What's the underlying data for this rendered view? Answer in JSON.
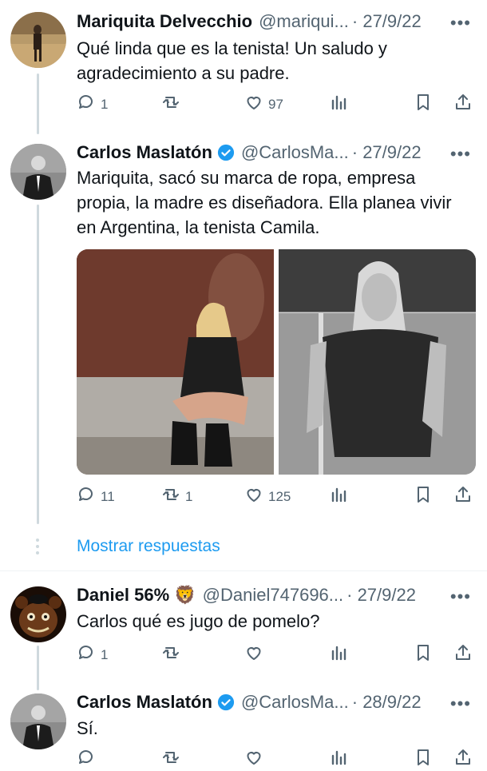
{
  "tweets": [
    {
      "name": "Mariquita Delvecchio",
      "handle": "@mariqui...",
      "date": "· 27/9/22",
      "verified": false,
      "text": "Qué linda que es la tenista!  Un saludo y agradecimiento a su padre.",
      "replies": "1",
      "retweets": "",
      "likes": "97"
    },
    {
      "name": "Carlos Maslatón",
      "handle": "@CarlosMa...",
      "date": "· 27/9/22",
      "verified": true,
      "text": "Mariquita, sacó su marca de ropa, empresa propia, la madre es diseñadora. Ella planea vivir en Argentina, la tenista Camila.",
      "replies": "11",
      "retweets": "1",
      "likes": "125"
    },
    {
      "name": "Daniel 56% 🦁",
      "handle": "@Daniel747696...",
      "date": "· 27/9/22",
      "verified": false,
      "text": "Carlos qué es jugo de pomelo?",
      "replies": "1",
      "retweets": "",
      "likes": ""
    },
    {
      "name": "Carlos Maslatón",
      "handle": "@CarlosMa...",
      "date": "· 28/9/22",
      "verified": true,
      "text": "Sí.",
      "replies": "",
      "retweets": "",
      "likes": ""
    }
  ],
  "show_replies_label": "Mostrar respuestas",
  "colors": {
    "accent": "#1d9bf0",
    "muted": "#536471",
    "line": "#cfd9de"
  },
  "icons": [
    "reply-icon",
    "retweet-icon",
    "like-icon",
    "views-icon",
    "bookmark-icon",
    "share-icon",
    "verified-badge-icon",
    "more-icon"
  ]
}
